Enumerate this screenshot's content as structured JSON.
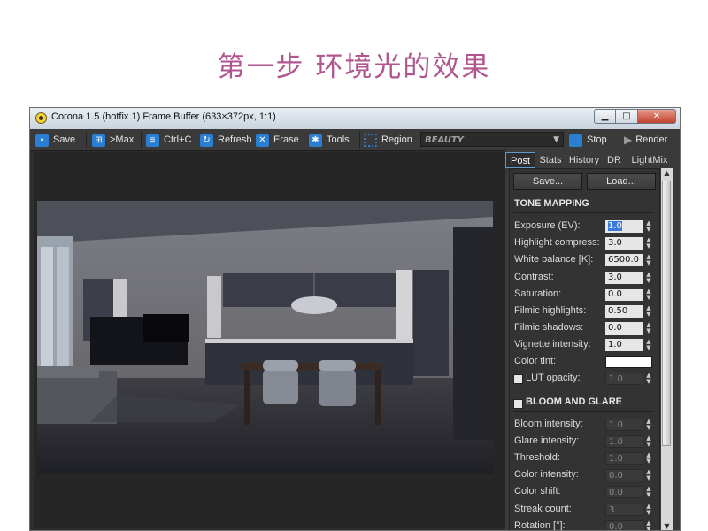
{
  "page": {
    "title": "第一步  环境光的效果"
  },
  "window": {
    "title": "Corona 1.5 (hotfix 1) Frame Buffer (633×372px, 1:1)",
    "min_glyph": "▁",
    "max_glyph": "□",
    "close_glyph": "✕"
  },
  "toolbar": {
    "save": "Save",
    "max": ">Max",
    "copy": "Ctrl+C",
    "refresh": "Refresh",
    "erase": "Erase",
    "tools": "Tools",
    "region": "Region",
    "channel": "BEAUTY",
    "stop": "Stop",
    "render": "Render"
  },
  "tabs": [
    "Post",
    "Stats",
    "History",
    "DR",
    "LightMix"
  ],
  "panel": {
    "save_btn": "Save...",
    "load_btn": "Load...",
    "tone_mapping": {
      "title": "TONE MAPPING",
      "rows": [
        {
          "label": "Exposure (EV):",
          "value": "1.0"
        },
        {
          "label": "Highlight compress:",
          "value": "3.0"
        },
        {
          "label": "White balance [K]:",
          "value": "6500.0"
        },
        {
          "label": "Contrast:",
          "value": "3.0"
        },
        {
          "label": "Saturation:",
          "value": "0.0"
        },
        {
          "label": "Filmic highlights:",
          "value": "0.50"
        },
        {
          "label": "Filmic shadows:",
          "value": "0.0"
        },
        {
          "label": "Vignette intensity:",
          "value": "1.0"
        }
      ],
      "color_tint_label": "Color tint:",
      "color_tint": "#ffffff",
      "lut_label": "LUT opacity:",
      "lut_value": "1.0"
    },
    "bloom": {
      "title": "BLOOM AND GLARE",
      "rows": [
        {
          "label": "Bloom intensity:",
          "value": "1.0"
        },
        {
          "label": "Glare intensity:",
          "value": "1.0"
        },
        {
          "label": "Threshold:",
          "value": "1.0"
        },
        {
          "label": "Color intensity:",
          "value": "0.0"
        },
        {
          "label": "Color shift:",
          "value": "0.0"
        },
        {
          "label": "Streak count:",
          "value": "3"
        },
        {
          "label": "Rotation [°]:",
          "value": "0.0"
        }
      ]
    }
  }
}
